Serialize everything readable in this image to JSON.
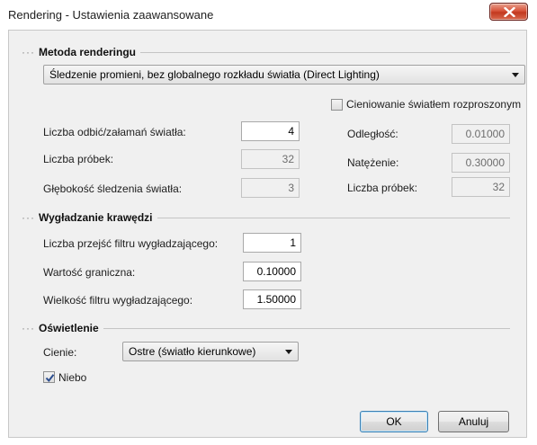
{
  "window": {
    "title": "Rendering - Ustawienia zaawansowane",
    "close_glyph": "x"
  },
  "rendering_method": {
    "section_title": "Metoda renderingu",
    "method_select": "Śledzenie promieni, bez globalnego rozkładu światła (Direct Lighting)",
    "diffuse_shading_label": "Cieniowanie światłem rozproszonym",
    "diffuse_shading_checked": false,
    "bounces_label": "Liczba odbić/załamań światła:",
    "bounces_value": "4",
    "samples_label": "Liczba próbek:",
    "samples_value": "32",
    "depth_label": "Głębokość śledzenia światła:",
    "depth_value": "3",
    "distance_label": "Odległość:",
    "distance_value": "0.01000",
    "intensity_label": "Natężenie:",
    "intensity_value": "0.30000",
    "diffuse_samples_label": "Liczba próbek:",
    "diffuse_samples_value": "32"
  },
  "antialiasing": {
    "section_title": "Wygładzanie krawędzi",
    "passes_label": "Liczba przejść filtru wygładzającego:",
    "passes_value": "1",
    "threshold_label": "Wartość graniczna:",
    "threshold_value": "0.10000",
    "filter_size_label": "Wielkość filtru wygładzającego:",
    "filter_size_value": "1.50000"
  },
  "lighting": {
    "section_title": "Oświetlenie",
    "shadows_label": "Cienie:",
    "shadows_select": "Ostre (światło kierunkowe)",
    "sky_label": "Niebo",
    "sky_checked": true
  },
  "buttons": {
    "ok": "OK",
    "cancel": "Anuluj"
  }
}
